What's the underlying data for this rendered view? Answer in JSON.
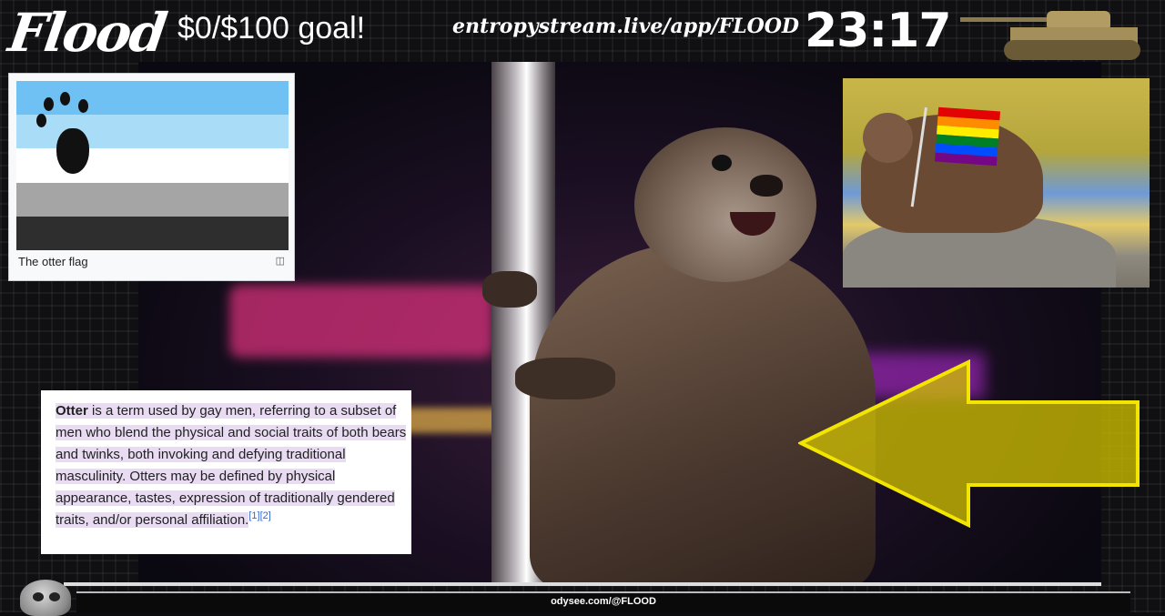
{
  "header": {
    "logo_text": "Flood",
    "goal_text": "$0/$100 goal!",
    "stream_url": "entropystream.live/app/FLOOD",
    "timer": "23:17"
  },
  "otter_flag": {
    "caption": "The otter flag",
    "stripe_colors": [
      "#6ec1f2",
      "#a9dcf7",
      "#ffffff",
      "#a5a5a5",
      "#2e2e2e"
    ]
  },
  "definition": {
    "term": "Otter",
    "text": " is a term used by gay men, referring to a subset of men who blend the physical and social traits of both bears and twinks, both invoking and defying traditional masculinity. Otters may be defined by physical appearance, tastes, expression of traditionally gendered traits, and/or personal affiliation.",
    "refs": "[1][2]"
  },
  "rainbow_flag_colors": [
    "#e40303",
    "#ff8c00",
    "#ffed00",
    "#008026",
    "#004dff",
    "#750787"
  ],
  "arrow_color": "#d4c400",
  "footer": {
    "channel": "odysee.com/@FLOOD"
  }
}
